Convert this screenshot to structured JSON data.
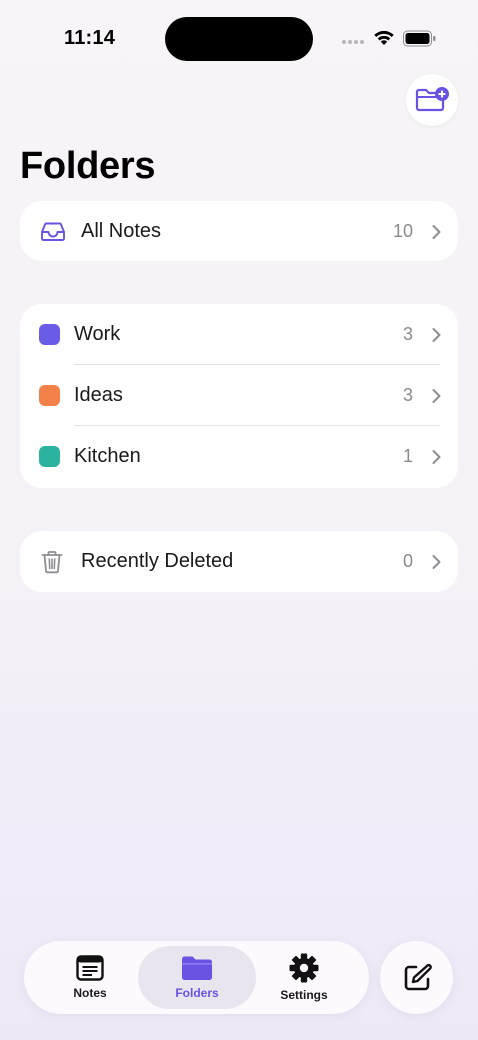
{
  "status_bar": {
    "time": "11:14"
  },
  "header": {
    "title": "Folders",
    "add_folder_icon": "folder-plus-icon"
  },
  "all_notes": {
    "label": "All Notes",
    "count": "10",
    "icon": "tray-icon"
  },
  "folders": [
    {
      "label": "Work",
      "count": "3",
      "color": "#6B5CE7"
    },
    {
      "label": "Ideas",
      "count": "3",
      "color": "#F5814A"
    },
    {
      "label": "Kitchen",
      "count": "1",
      "color": "#2BB3A0"
    }
  ],
  "recently_deleted": {
    "label": "Recently Deleted",
    "count": "0",
    "icon": "trash-icon"
  },
  "tab_bar": {
    "tabs": [
      {
        "label": "Notes",
        "icon": "notes-icon",
        "selected": false
      },
      {
        "label": "Folders",
        "icon": "folder-icon",
        "selected": true
      },
      {
        "label": "Settings",
        "icon": "gear-icon",
        "selected": false
      }
    ],
    "compose_icon": "compose-icon"
  },
  "colors": {
    "accent": "#6A53E3",
    "background": "#F5F2F7",
    "card": "#FFFFFF"
  }
}
